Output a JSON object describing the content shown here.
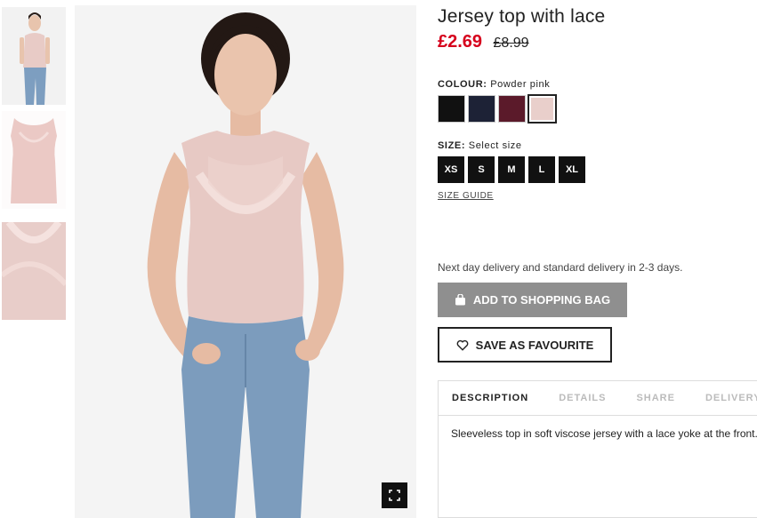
{
  "product": {
    "title": "Jersey top with lace",
    "price_current": "£2.69",
    "price_old": "£8.99"
  },
  "colour": {
    "label": "COLOUR:",
    "selected": "Powder pink",
    "swatches": [
      {
        "name": "Black",
        "color": "#111111"
      },
      {
        "name": "Dark blue",
        "color": "#1d2236"
      },
      {
        "name": "Burgundy",
        "color": "#5b1a2a"
      },
      {
        "name": "Powder pink",
        "color": "#e9cfcb",
        "selected": true
      }
    ]
  },
  "size": {
    "label": "SIZE:",
    "placeholder": "Select size",
    "options": [
      "XS",
      "S",
      "M",
      "L",
      "XL"
    ],
    "guide_label": "SIZE GUIDE"
  },
  "delivery_text": "Next day delivery and standard delivery in 2-3 days.",
  "actions": {
    "add_to_bag": "ADD TO SHOPPING BAG",
    "save_favourite": "SAVE AS FAVOURITE"
  },
  "tabs": {
    "items": [
      "DESCRIPTION",
      "DETAILS",
      "SHARE",
      "DELIVERY A"
    ],
    "active": "DESCRIPTION",
    "content": "Sleeveless top in soft viscose jersey with a lace yoke at the front."
  },
  "icons": {
    "bag": "shopping-bag-icon",
    "heart": "heart-icon",
    "fullscreen": "fullscreen-icon"
  },
  "colors": {
    "price_red": "#d6001c",
    "bag_button": "#8f8f8f",
    "size_button": "#111111"
  }
}
